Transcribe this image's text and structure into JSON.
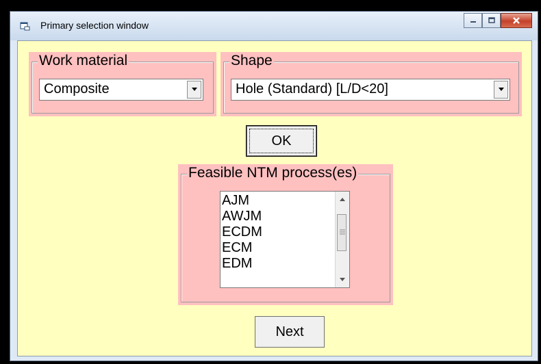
{
  "window": {
    "title": "Primary selection window"
  },
  "work_material": {
    "label": "Work material",
    "value": "Composite"
  },
  "shape": {
    "label": "Shape",
    "value": "Hole (Standard) [L/D<20]"
  },
  "ok_button": {
    "label": "OK"
  },
  "feasible": {
    "label": "Feasible NTM process(es)",
    "items": [
      "AJM",
      "AWJM",
      "ECDM",
      "ECM",
      "EDM"
    ]
  },
  "next_button": {
    "label": "Next"
  },
  "colors": {
    "form_bg": "#ffffc0",
    "group_bg": "#ffc0c0",
    "close_red": "#c4422b"
  }
}
